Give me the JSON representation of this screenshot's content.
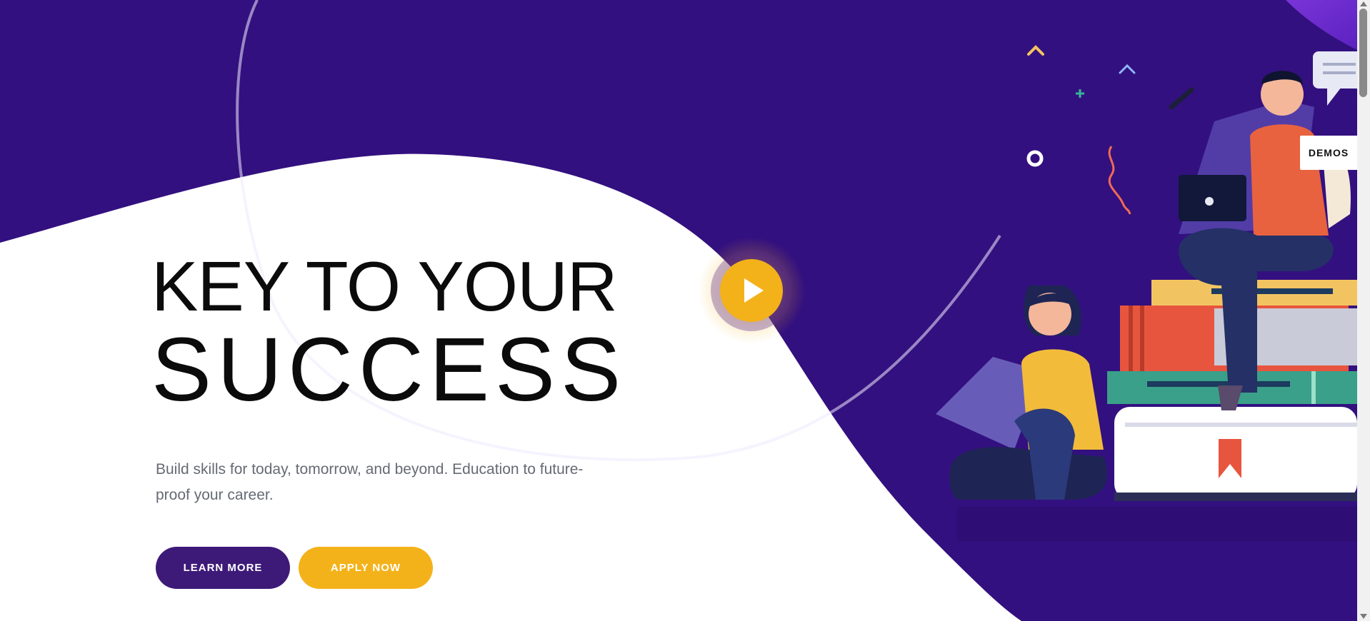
{
  "hero": {
    "title_line1": "KEY TO YOUR",
    "title_line2": "SUCCESS",
    "subtitle": "Build skills for today, tomorrow, and beyond. Education to future-proof your career.",
    "learn_more_label": "LEARN MORE",
    "apply_now_label": "APPLY NOW",
    "play_icon": "play-icon"
  },
  "side_panel": {
    "demos_label": "DEMOS"
  },
  "colors": {
    "hero_purple": "#33107f",
    "button_purple": "#3d1a78",
    "accent_yellow": "#f4b21a",
    "title_text": "#0b0b0b",
    "body_text": "#666a73"
  }
}
